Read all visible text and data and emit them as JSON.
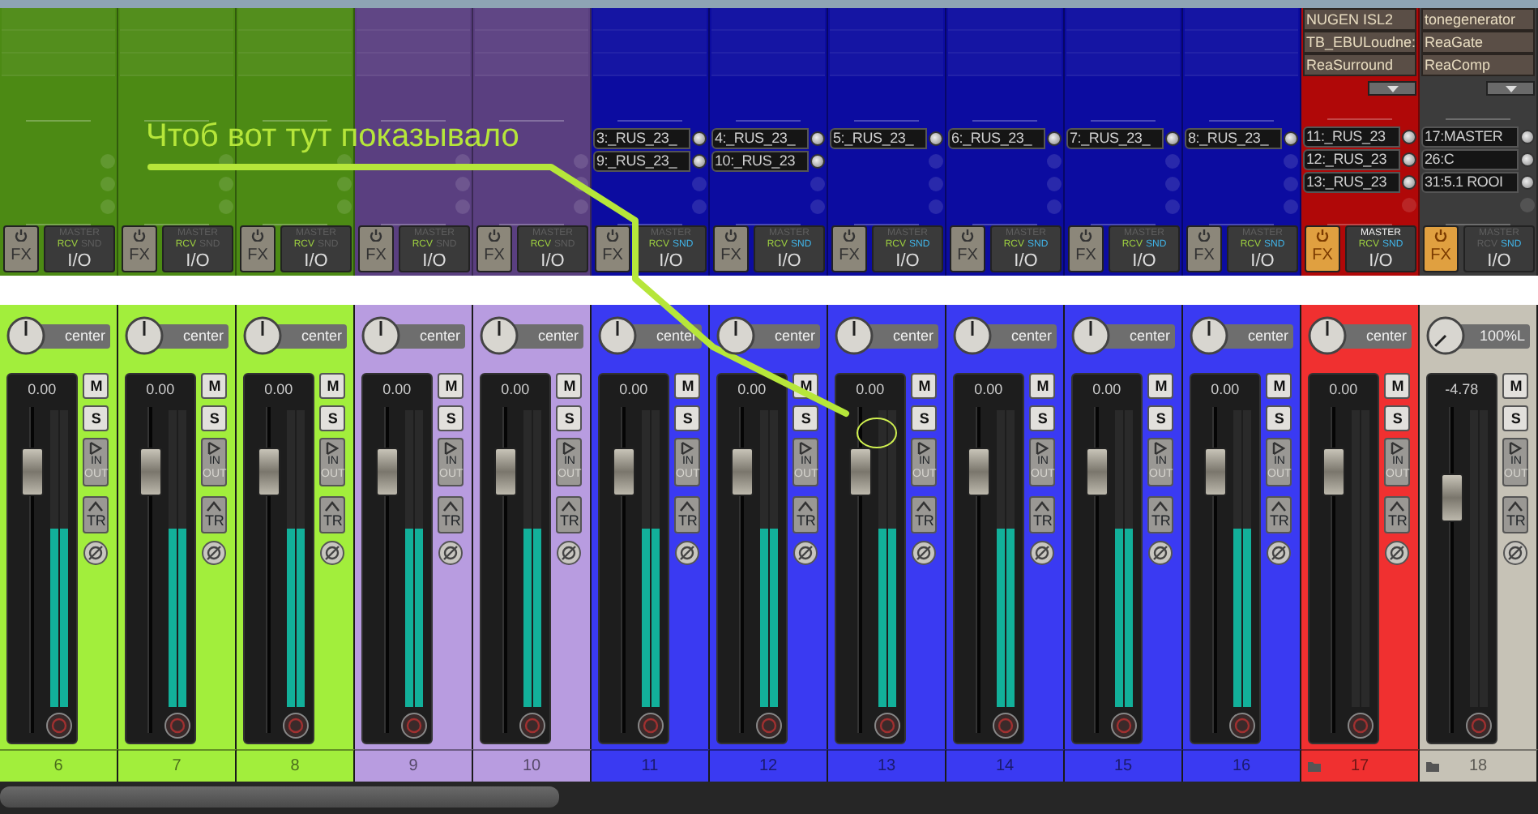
{
  "annotation": {
    "text": "Чтоб вот тут показывало"
  },
  "channels": [
    {
      "number": "6",
      "color": "#a2ee3c",
      "top": {
        "color": "#4c8a14",
        "fx_button": {
          "label": "FX",
          "on": false
        },
        "io_button": {
          "label": "I/O",
          "master": {
            "label": "MASTER",
            "on": false
          },
          "rcv": {
            "label": "RCV",
            "on": true
          },
          "snd": {
            "label": "SND",
            "on": false
          }
        }
      },
      "pan": "center",
      "volume": "0.00",
      "fader": {
        "level": 0.8
      },
      "meters": [
        {
          "level": 0.6
        },
        {
          "level": 0.6
        }
      ],
      "mute": "M",
      "solo": "S",
      "input": "IN",
      "output": "OUT",
      "trim": "TR",
      "folder": false
    },
    {
      "number": "7",
      "color": "#a2ee3c",
      "top": {
        "color": "#4c8a14",
        "fx_button": {
          "label": "FX",
          "on": false
        },
        "io_button": {
          "label": "I/O",
          "master": {
            "label": "MASTER",
            "on": false
          },
          "rcv": {
            "label": "RCV",
            "on": true
          },
          "snd": {
            "label": "SND",
            "on": false
          }
        }
      },
      "pan": "center",
      "volume": "0.00",
      "fader": {
        "level": 0.8
      },
      "meters": [
        {
          "level": 0.6
        },
        {
          "level": 0.6
        }
      ],
      "mute": "M",
      "solo": "S",
      "input": "IN",
      "output": "OUT",
      "trim": "TR",
      "folder": false
    },
    {
      "number": "8",
      "color": "#a2ee3c",
      "top": {
        "color": "#4c8a14",
        "fx_button": {
          "label": "FX",
          "on": false
        },
        "io_button": {
          "label": "I/O",
          "master": {
            "label": "MASTER",
            "on": false
          },
          "rcv": {
            "label": "RCV",
            "on": true
          },
          "snd": {
            "label": "SND",
            "on": false
          }
        }
      },
      "pan": "center",
      "volume": "0.00",
      "fader": {
        "level": 0.8
      },
      "meters": [
        {
          "level": 0.6
        },
        {
          "level": 0.6
        }
      ],
      "mute": "M",
      "solo": "S",
      "input": "IN",
      "output": "OUT",
      "trim": "TR",
      "folder": false
    },
    {
      "number": "9",
      "color": "#b89ce0",
      "top": {
        "color": "#5a3f80",
        "fx_button": {
          "label": "FX",
          "on": false
        },
        "io_button": {
          "label": "I/O",
          "master": {
            "label": "MASTER",
            "on": false
          },
          "rcv": {
            "label": "RCV",
            "on": true
          },
          "snd": {
            "label": "SND",
            "on": false
          }
        }
      },
      "pan": "center",
      "volume": "0.00",
      "fader": {
        "level": 0.8
      },
      "meters": [
        {
          "level": 0.6
        },
        {
          "level": 0.6
        }
      ],
      "mute": "M",
      "solo": "S",
      "input": "IN",
      "output": "OUT",
      "trim": "TR",
      "folder": false
    },
    {
      "number": "10",
      "color": "#b89ce0",
      "top": {
        "color": "#5a3f80",
        "fx_button": {
          "label": "FX",
          "on": false
        },
        "io_button": {
          "label": "I/O",
          "master": {
            "label": "MASTER",
            "on": false
          },
          "rcv": {
            "label": "RCV",
            "on": true
          },
          "snd": {
            "label": "SND",
            "on": false
          }
        }
      },
      "pan": "center",
      "volume": "0.00",
      "fader": {
        "level": 0.8
      },
      "meters": [
        {
          "level": 0.6
        },
        {
          "level": 0.6
        }
      ],
      "mute": "M",
      "solo": "S",
      "input": "IN",
      "output": "OUT",
      "trim": "TR",
      "folder": false
    },
    {
      "number": "11",
      "color": "#3a3af2",
      "top": {
        "color": "#0c0ca0",
        "sends": [
          "3:_RUS_23_",
          "9:_RUS_23_"
        ],
        "fx_button": {
          "label": "FX",
          "on": false
        },
        "io_button": {
          "label": "I/O",
          "master": {
            "label": "MASTER",
            "on": false
          },
          "rcv": {
            "label": "RCV",
            "on": true
          },
          "snd": {
            "label": "SND",
            "on": true
          }
        }
      },
      "pan": "center",
      "volume": "0.00",
      "fader": {
        "level": 0.8
      },
      "meters": [
        {
          "level": 0.6
        },
        {
          "level": 0.6
        }
      ],
      "mute": "M",
      "solo": "S",
      "input": "IN",
      "output": "OUT",
      "trim": "TR",
      "folder": false
    },
    {
      "number": "12",
      "color": "#3a3af2",
      "top": {
        "color": "#0c0ca0",
        "sends": [
          "4:_RUS_23_",
          "10:_RUS_23"
        ],
        "fx_button": {
          "label": "FX",
          "on": false
        },
        "io_button": {
          "label": "I/O",
          "master": {
            "label": "MASTER",
            "on": false
          },
          "rcv": {
            "label": "RCV",
            "on": true
          },
          "snd": {
            "label": "SND",
            "on": true
          }
        }
      },
      "pan": "center",
      "volume": "0.00",
      "fader": {
        "level": 0.8
      },
      "meters": [
        {
          "level": 0.6
        },
        {
          "level": 0.6
        }
      ],
      "mute": "M",
      "solo": "S",
      "input": "IN",
      "output": "OUT",
      "trim": "TR",
      "folder": false
    },
    {
      "number": "13",
      "color": "#3a3af2",
      "top": {
        "color": "#0c0ca0",
        "sends": [
          "5:_RUS_23_"
        ],
        "fx_button": {
          "label": "FX",
          "on": false
        },
        "io_button": {
          "label": "I/O",
          "master": {
            "label": "MASTER",
            "on": false
          },
          "rcv": {
            "label": "RCV",
            "on": true
          },
          "snd": {
            "label": "SND",
            "on": true
          }
        }
      },
      "pan": "center",
      "volume": "0.00",
      "fader": {
        "level": 0.8
      },
      "meters": [
        {
          "level": 0.6
        },
        {
          "level": 0.6
        }
      ],
      "mute": "M",
      "solo": "S",
      "input": "IN",
      "output": "OUT",
      "trim": "TR",
      "folder": false
    },
    {
      "number": "14",
      "color": "#3a3af2",
      "top": {
        "color": "#0c0ca0",
        "sends": [
          "6:_RUS_23_"
        ],
        "fx_button": {
          "label": "FX",
          "on": false
        },
        "io_button": {
          "label": "I/O",
          "master": {
            "label": "MASTER",
            "on": false
          },
          "rcv": {
            "label": "RCV",
            "on": true
          },
          "snd": {
            "label": "SND",
            "on": true
          }
        }
      },
      "pan": "center",
      "volume": "0.00",
      "fader": {
        "level": 0.8
      },
      "meters": [
        {
          "level": 0.6
        },
        {
          "level": 0.6
        }
      ],
      "mute": "M",
      "solo": "S",
      "input": "IN",
      "output": "OUT",
      "trim": "TR",
      "folder": false
    },
    {
      "number": "15",
      "color": "#3a3af2",
      "top": {
        "color": "#0c0ca0",
        "sends": [
          "7:_RUS_23_"
        ],
        "fx_button": {
          "label": "FX",
          "on": false
        },
        "io_button": {
          "label": "I/O",
          "master": {
            "label": "MASTER",
            "on": false
          },
          "rcv": {
            "label": "RCV",
            "on": true
          },
          "snd": {
            "label": "SND",
            "on": true
          }
        }
      },
      "pan": "center",
      "volume": "0.00",
      "fader": {
        "level": 0.8
      },
      "meters": [
        {
          "level": 0.6
        },
        {
          "level": 0.6
        }
      ],
      "mute": "M",
      "solo": "S",
      "input": "IN",
      "output": "OUT",
      "trim": "TR",
      "folder": false
    },
    {
      "number": "16",
      "color": "#3a3af2",
      "top": {
        "color": "#0c0ca0",
        "sends": [
          "8:_RUS_23_"
        ],
        "fx_button": {
          "label": "FX",
          "on": false
        },
        "io_button": {
          "label": "I/O",
          "master": {
            "label": "MASTER",
            "on": false
          },
          "rcv": {
            "label": "RCV",
            "on": true
          },
          "snd": {
            "label": "SND",
            "on": true
          }
        }
      },
      "pan": "center",
      "volume": "0.00",
      "fader": {
        "level": 0.8
      },
      "meters": [
        {
          "level": 0.6
        },
        {
          "level": 0.6
        }
      ],
      "mute": "M",
      "solo": "S",
      "input": "IN",
      "output": "OUT",
      "trim": "TR",
      "folder": false
    },
    {
      "number": "17",
      "color": "#f03030",
      "top": {
        "color": "#b00808",
        "fx": [
          "NUGEN ISL2",
          "TB_EBULoudne:",
          "ReaSurround"
        ],
        "sends": [
          "11:_RUS_23",
          "12:_RUS_23",
          "13:_RUS_23"
        ],
        "fx_button": {
          "label": "FX",
          "on": true
        },
        "io_button": {
          "label": "I/O",
          "master": {
            "label": "MASTER",
            "on": true
          },
          "rcv": {
            "label": "RCV",
            "on": true
          },
          "snd": {
            "label": "SND",
            "on": true
          }
        }
      },
      "pan": "center",
      "volume": "0.00",
      "fader": {
        "level": 0.8
      },
      "meters": [
        {
          "level": 0
        },
        {
          "level": 0
        }
      ],
      "mute": "M",
      "solo": "S",
      "input": "IN",
      "output": "OUT",
      "trim": "TR",
      "folder": true
    },
    {
      "number": "18",
      "color": "#c6c2b6",
      "top": {
        "color": "#3c3c3c",
        "fx": [
          "tonegenerator",
          "ReaGate",
          "ReaComp"
        ],
        "sends": [
          "17:MASTER",
          "26:C",
          "31:5.1 ROOI"
        ],
        "fx_button": {
          "label": "FX",
          "on": true
        },
        "io_button": {
          "label": "I/O",
          "master": {
            "label": "MASTER",
            "on": false
          },
          "rcv": {
            "label": "RCV",
            "on": false
          },
          "snd": {
            "label": "SND",
            "on": true
          }
        }
      },
      "pan": "100%L",
      "volume": "-4.78",
      "fader": {
        "level": 0.72
      },
      "meters": [
        {
          "level": 0
        },
        {
          "level": 0
        }
      ],
      "mute": "M",
      "solo": "S",
      "input": "IN",
      "output": "OUT",
      "trim": "TR",
      "folder": true
    }
  ]
}
